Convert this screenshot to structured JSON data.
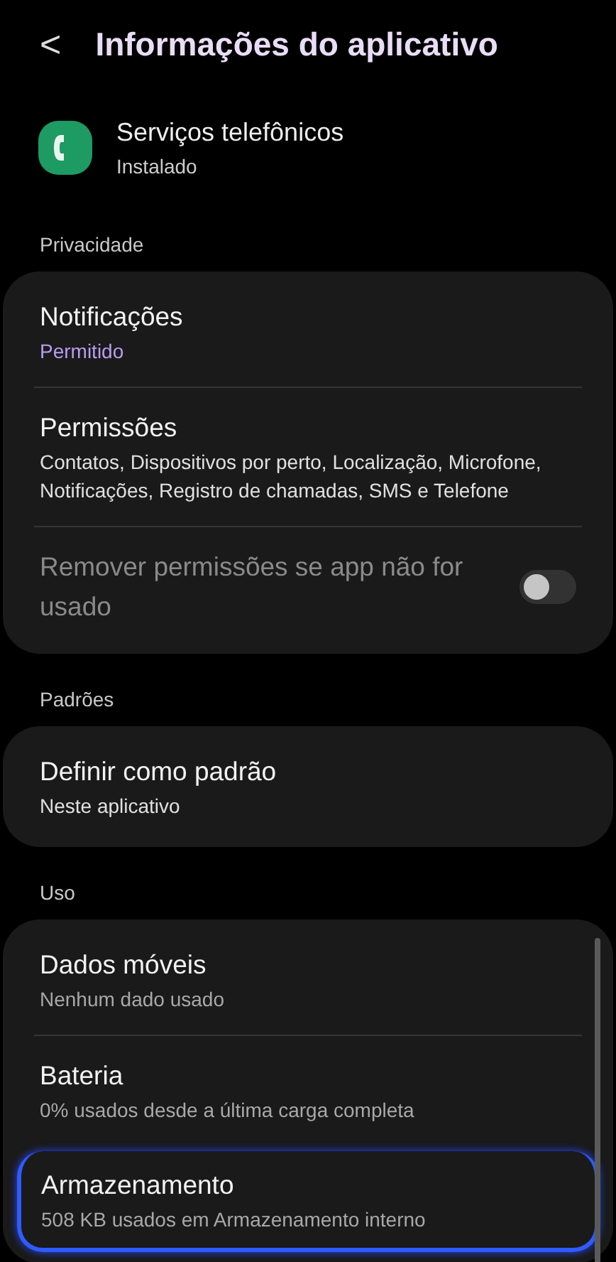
{
  "header": {
    "back_glyph": "<",
    "title": "Informações do aplicativo"
  },
  "app": {
    "name": "Serviços telefônicos",
    "status": "Instalado"
  },
  "sections": [
    {
      "label": "Privacidade",
      "items": [
        {
          "kind": "nav",
          "title": "Notificações",
          "subtitle": "Permitido",
          "accent": true,
          "highlighted": false
        },
        {
          "kind": "nav",
          "title": "Permissões",
          "subtitle": "Contatos, Dispositivos por perto, Localização, Microfone, Notificações, Registro de chamadas, SMS e Telefone",
          "accent": false,
          "highlighted": false
        },
        {
          "kind": "toggle",
          "title": "Remover permissões se app não for usado",
          "on": false,
          "disabled": true
        }
      ]
    },
    {
      "label": "Padrões",
      "items": [
        {
          "kind": "nav",
          "title": "Definir como padrão",
          "subtitle": "Neste aplicativo",
          "accent": false,
          "highlighted": false
        }
      ]
    },
    {
      "label": "Uso",
      "items": [
        {
          "kind": "nav",
          "title": "Dados móveis",
          "subtitle": "Nenhum dado usado",
          "accent": false,
          "highlighted": false
        },
        {
          "kind": "nav",
          "title": "Bateria",
          "subtitle": "0% usados desde a última carga completa",
          "accent": false,
          "highlighted": false
        },
        {
          "kind": "nav",
          "title": "Armazenamento",
          "subtitle": "508 KB usados em Armazenamento interno",
          "accent": false,
          "highlighted": true
        }
      ]
    }
  ]
}
